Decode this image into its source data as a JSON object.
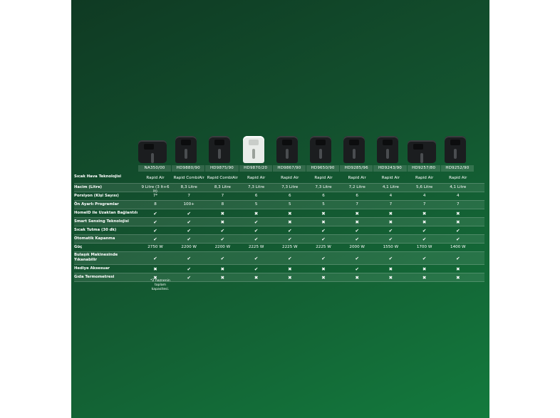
{
  "models": [
    "NA350/00",
    "HD9880/90",
    "HD9875/90",
    "HD9870/20",
    "HD9867/90",
    "HD9650/90",
    "HD9285/96",
    "HD9243/90",
    "HD9257/80",
    "HD9252/90"
  ],
  "product_images": [
    "air-fryer-dual",
    "air-fryer",
    "air-fryer",
    "air-fryer-white",
    "air-fryer",
    "air-fryer",
    "air-fryer",
    "air-fryer",
    "air-fryer-wide",
    "air-fryer"
  ],
  "rows": [
    {
      "label": "Sıcak Hava Teknolojisi",
      "values": [
        "Rapid Air",
        "Rapid CombiAir",
        "Rapid CombiAir",
        "Rapid Air",
        "Rapid Air",
        "Rapid Air",
        "Rapid Air",
        "Rapid Air",
        "Rapid Air",
        "Rapid Air"
      ]
    },
    {
      "label": "Hacim (Litre)",
      "values": [
        "9 Litre (3 lt+6 lt)",
        "8,3 Litre",
        "8,3 Litre",
        "7,3 Litre",
        "7,3 Litre",
        "7,3 Litre",
        "7,2 Litre",
        "4,1 Litre",
        "5,6 Litre",
        "4,1 Litre"
      ]
    },
    {
      "label": "Porsiyon (Kişi Sayısı)",
      "values": [
        "7*",
        "7",
        "7",
        "6",
        "6",
        "6",
        "6",
        "4",
        "4",
        "4"
      ]
    },
    {
      "label": "Ön Ayarlı Programlar",
      "values": [
        "8",
        "100+",
        "8",
        "5",
        "5",
        "5",
        "7",
        "7",
        "7",
        "7"
      ]
    },
    {
      "label": "HomeID ile Uzaktan Bağlantılı",
      "values": [
        "✔",
        "✔",
        "✖",
        "✖",
        "✖",
        "✖",
        "✖",
        "✖",
        "✖",
        "✖"
      ]
    },
    {
      "label": "Smart Sensing Teknolojisi",
      "values": [
        "✔",
        "✔",
        "✖",
        "✔",
        "✖",
        "✖",
        "✖",
        "✖",
        "✖",
        "✖"
      ]
    },
    {
      "label": "Sıcak Tutma (30 dk)",
      "values": [
        "✔",
        "✔",
        "✔",
        "✔",
        "✔",
        "✔",
        "✔",
        "✔",
        "✔",
        "✔"
      ]
    },
    {
      "label": "Otomatik Kapanma",
      "values": [
        "✔",
        "✔",
        "✔",
        "✔",
        "✔",
        "✔",
        "✔",
        "✔",
        "✔",
        "✔"
      ]
    },
    {
      "label": "Güç",
      "values": [
        "2750  W",
        "2200 W",
        "2200 W",
        "2225 W",
        "2225 W",
        "2225 W",
        "2000 W",
        "1550 W",
        "1700 W",
        "1400 W"
      ]
    },
    {
      "label": "Bulaşık Makinesinde Yıkanabilir",
      "values": [
        "✔",
        "✔",
        "✔",
        "✔",
        "✔",
        "✔",
        "✔",
        "✔",
        "✔",
        "✔"
      ]
    },
    {
      "label": "Hediye Aksesuar",
      "values": [
        "✖",
        "✔",
        "✖",
        "✔",
        "✖",
        "✖",
        "✔",
        "✖",
        "✖",
        "✖"
      ]
    },
    {
      "label": "Gıda Termometresi",
      "values": [
        "✖",
        "✔",
        "✖",
        "✖",
        "✖",
        "✖",
        "✖",
        "✖",
        "✖",
        "✖"
      ]
    }
  ],
  "footnote": "*2 haznenin toplam kapasitesi."
}
